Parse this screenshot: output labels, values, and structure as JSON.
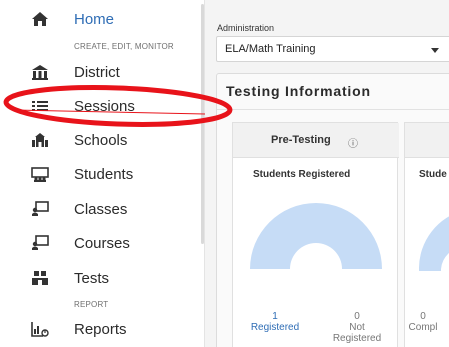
{
  "sidebar": {
    "section_create": "CREATE, EDIT, MONITOR",
    "section_report": "REPORT",
    "items": [
      {
        "label": "Home",
        "icon": "home-icon"
      },
      {
        "label": "District",
        "icon": "district-icon"
      },
      {
        "label": "Sessions",
        "icon": "sessions-icon"
      },
      {
        "label": "Schools",
        "icon": "schools-icon"
      },
      {
        "label": "Students",
        "icon": "students-icon"
      },
      {
        "label": "Classes",
        "icon": "classes-icon"
      },
      {
        "label": "Courses",
        "icon": "courses-icon"
      },
      {
        "label": "Tests",
        "icon": "tests-icon"
      },
      {
        "label": "Reports",
        "icon": "reports-icon"
      }
    ]
  },
  "main": {
    "admin_label": "Administration",
    "admin_value": "ELA/Math Training",
    "testing_title": "Testing Information",
    "pre_testing": {
      "title": "Pre-Testing",
      "info_glyph": "ⓘ",
      "subtitle": "Students Registered",
      "registered_count": "1",
      "registered_label": "Registered",
      "not_registered_count": "0",
      "not_registered_label_1": "Not",
      "not_registered_label_2": "Registered",
      "registered_fraction": 1.0
    },
    "second_card": {
      "subtitle": "Stude",
      "completed_count": "0",
      "completed_label": "Compl"
    }
  },
  "colors": {
    "active": "#2f6db5",
    "gauge_fill": "#c6dcf6",
    "highlight": "#e8131a"
  }
}
